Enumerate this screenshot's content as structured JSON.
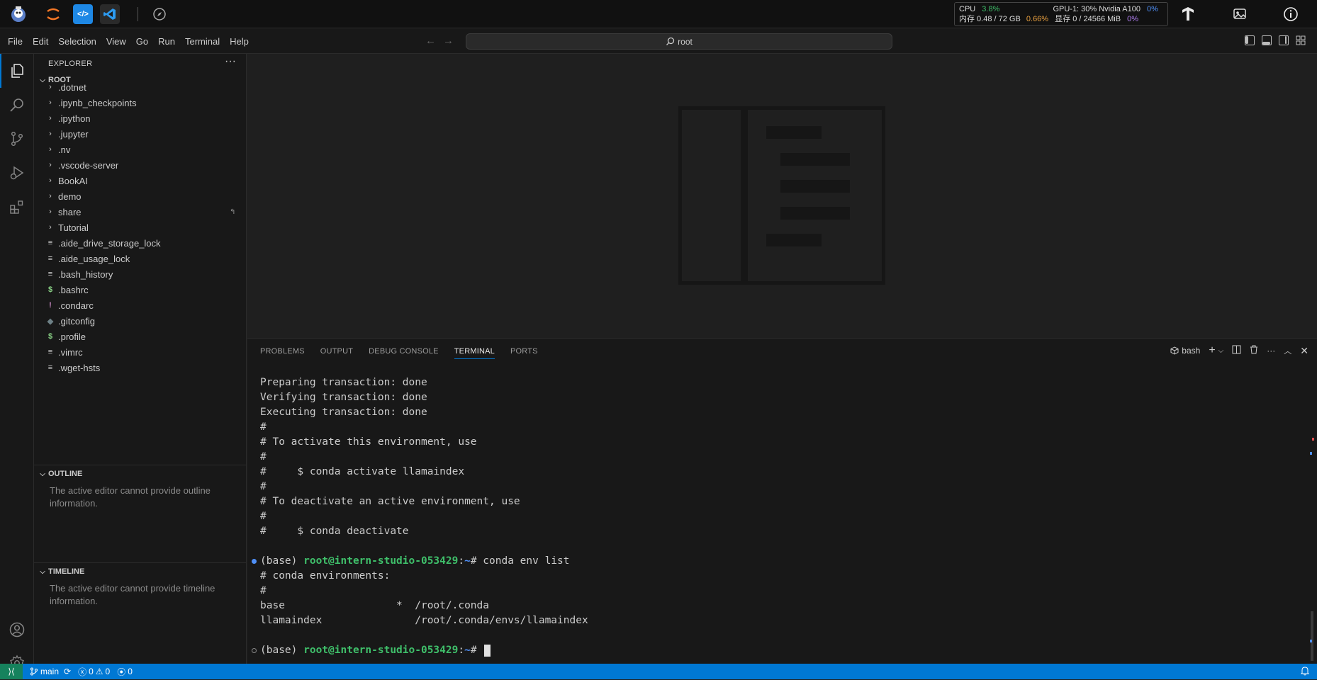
{
  "topbar": {
    "stats": {
      "cpu_label": "CPU",
      "cpu_value": "3.8%",
      "mem_label": "内存 0.48 / 72 GB",
      "mem_pct": "0.66%",
      "gpu_label": "GPU-1: 30% Nvidia A100",
      "gpu_pct": "0%",
      "vram_label": "显存 0 / 24566 MiB",
      "vram_pct": "0%"
    }
  },
  "menubar": {
    "items": [
      "File",
      "Edit",
      "Selection",
      "View",
      "Go",
      "Run",
      "Terminal",
      "Help"
    ],
    "search_text": "root"
  },
  "sidebar": {
    "title": "EXPLORER",
    "root_label": "ROOT",
    "folders": [
      ".dotnet",
      ".ipynb_checkpoints",
      ".ipython",
      ".jupyter",
      ".nv",
      ".vscode-server",
      "BookAI",
      "demo",
      "share",
      "Tutorial"
    ],
    "files": [
      {
        "name": ".aide_drive_storage_lock",
        "icon": "≡",
        "color": "#cccccc"
      },
      {
        "name": ".aide_usage_lock",
        "icon": "≡",
        "color": "#cccccc"
      },
      {
        "name": ".bash_history",
        "icon": "≡",
        "color": "#cccccc"
      },
      {
        "name": ".bashrc",
        "icon": "$",
        "color": "#89d185"
      },
      {
        "name": ".condarc",
        "icon": "!",
        "color": "#c586c0"
      },
      {
        "name": ".gitconfig",
        "icon": "◆",
        "color": "#6d8086"
      },
      {
        "name": ".profile",
        "icon": "$",
        "color": "#89d185"
      },
      {
        "name": ".vimrc",
        "icon": "≡",
        "color": "#cccccc"
      },
      {
        "name": ".wget-hsts",
        "icon": "≡",
        "color": "#cccccc"
      }
    ],
    "outline_title": "OUTLINE",
    "outline_text": "The active editor cannot provide outline information.",
    "timeline_title": "TIMELINE",
    "timeline_text": "The active editor cannot provide timeline information."
  },
  "panel": {
    "tabs": [
      "PROBLEMS",
      "OUTPUT",
      "DEBUG CONSOLE",
      "TERMINAL",
      "PORTS"
    ],
    "active_tab": "TERMINAL",
    "shell_label": "bash",
    "terminal_lines": [
      "Preparing transaction: done",
      "Verifying transaction: done",
      "Executing transaction: done",
      "#",
      "# To activate this environment, use",
      "#",
      "#     $ conda activate llamaindex",
      "#",
      "# To deactivate an active environment, use",
      "#",
      "#     $ conda deactivate"
    ],
    "prompt1": {
      "env": "(base) ",
      "user": "root@intern-studio-053429",
      "sep": ":",
      "path": "~",
      "hash": "# ",
      "cmd": "conda env list"
    },
    "env_output": [
      "# conda environments:",
      "#",
      "base                  *  /root/.conda",
      "llamaindex               /root/.conda/envs/llamaindex"
    ],
    "prompt2": {
      "env": "(base) ",
      "user": "root@intern-studio-053429",
      "sep": ":",
      "path": "~",
      "hash": "# "
    }
  },
  "statusbar": {
    "branch": "main",
    "errors": "0",
    "warnings": "0",
    "ports": "0"
  }
}
